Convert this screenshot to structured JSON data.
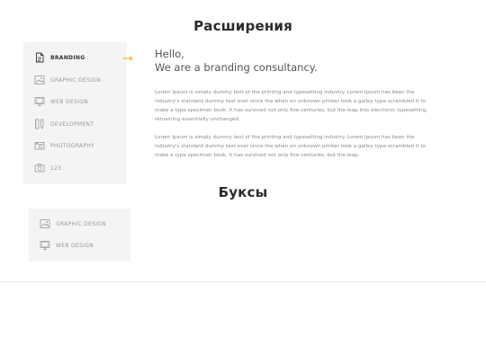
{
  "sections": [
    {
      "title": "Расширения",
      "tabs": [
        {
          "label": "BRANDING",
          "icon": "document-icon",
          "active": true
        },
        {
          "label": "GRAPHIC DESIGN",
          "icon": "image-icon",
          "active": false
        },
        {
          "label": "WEB DESIGN",
          "icon": "monitor-icon",
          "active": false
        },
        {
          "label": "DEVELOPMENT",
          "icon": "pencil-ruler-icon",
          "active": false
        },
        {
          "label": "PHOTOGRAPHY",
          "icon": "camera-icon",
          "active": false
        },
        {
          "label": "123",
          "icon": "photo-camera-icon",
          "active": false
        }
      ],
      "content": {
        "hello": "Hello,",
        "tagline": "We are a branding consultancy.",
        "paragraphs": [
          "Lorem Ipsum is simply dummy text of the printing and typesetting industry. Lorem Ipsum has been the industry's standard dummy text ever since the when an unknown printer took a galley type scrambled it to make a type specimen book. It has survived not only five centuries, but the leap into electronic typesetting, remaining essentially unchanged.",
          "Lorem Ipsum is simply dummy text of the printing and typesetting industry. Lorem Ipsum has been the industry's standard dummy text ever since the when an unknown printer took a galley type scrambled it to make a type specimen book. It has survived not only five centuries, but the leap."
        ]
      }
    },
    {
      "title": "Буксы",
      "tabs": [
        {
          "label": "GRAPHIC DESIGN",
          "icon": "image-icon",
          "active": false
        },
        {
          "label": "WEB DESIGN",
          "icon": "monitor-icon",
          "active": false
        }
      ]
    }
  ],
  "colors": {
    "accent": "#f2b632",
    "tab_bg": "#f4f4f4",
    "active_text": "#333333",
    "inactive_text": "#9a9a9a"
  }
}
